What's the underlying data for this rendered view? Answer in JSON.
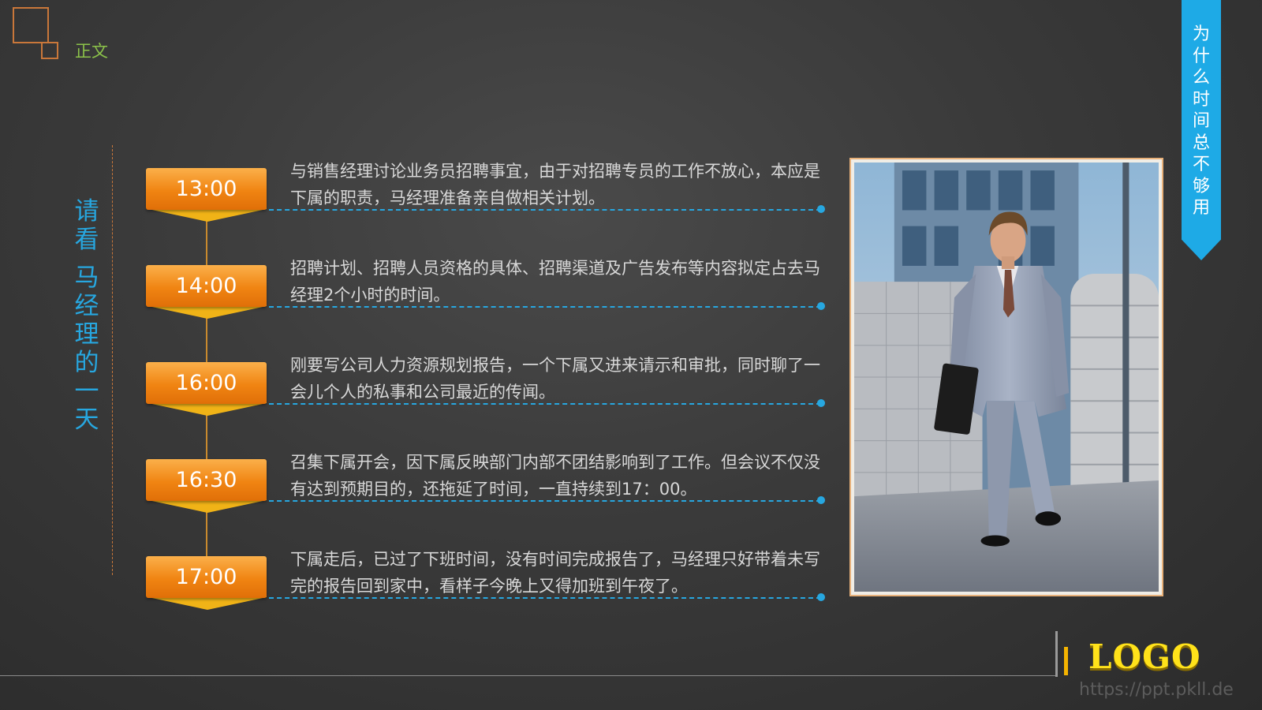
{
  "header": {
    "section_label": "正文"
  },
  "vertical_title": {
    "chars": [
      "请",
      "看",
      "",
      "马",
      "经",
      "理",
      "的",
      "一",
      "天"
    ]
  },
  "side_tab": {
    "chars": [
      "为",
      "什",
      "么",
      "时",
      "间",
      "总",
      "不",
      "够",
      "用"
    ]
  },
  "timeline": [
    {
      "time": "13:00",
      "text": "与销售经理讨论业务员招聘事宜，由于对招聘专员的工作不放心，本应是下属的职责，马经理准备亲自做相关计划。"
    },
    {
      "time": "14:00",
      "text": "招聘计划、招聘人员资格的具体、招聘渠道及广告发布等内容拟定占去马经理2个小时的时间。"
    },
    {
      "time": "16:00",
      "text": "刚要写公司人力资源规划报告，一个下属又进来请示和审批，同时聊了一会儿个人的私事和公司最近的传闻。"
    },
    {
      "time": "16:30",
      "text": "召集下属开会，因下属反映部门内部不团结影响到了工作。但会议不仅没有达到预期目的，还拖延了时间，一直持续到17：00。"
    },
    {
      "time": "17:00",
      "text": "下属走后，已过了下班时间，没有时间完成报告了，马经理只好带着未写完的报告回到家中，看样子今晚上又得加班到午夜了。"
    }
  ],
  "footer": {
    "logo": "LOGO",
    "watermark": "https://ppt.pkll.de"
  },
  "colors": {
    "accent_blue": "#27a7e0",
    "accent_orange": "#f08412",
    "ribbon_yellow": "#f0b317",
    "label_green": "#8cc34a"
  }
}
